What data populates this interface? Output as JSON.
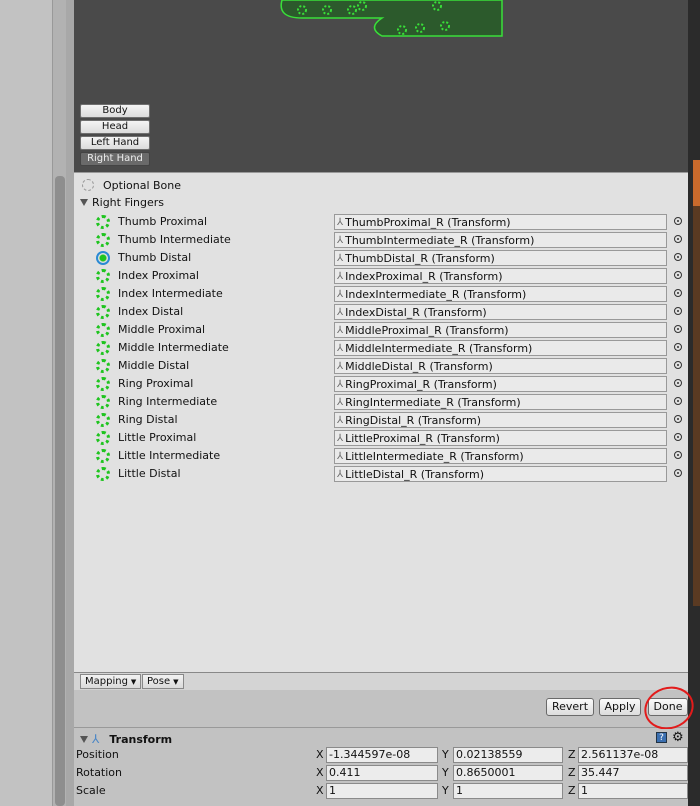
{
  "body_parts": {
    "items": [
      "Body",
      "Head",
      "Left Hand",
      "Right Hand"
    ],
    "active": "Right Hand"
  },
  "optional_bone_label": "Optional Bone",
  "section_title": "Right Fingers",
  "bones": [
    {
      "label": "Thumb Proximal",
      "value": "ThumbProximal_R (Transform)"
    },
    {
      "label": "Thumb Intermediate",
      "value": "ThumbIntermediate_R (Transform)"
    },
    {
      "label": "Thumb Distal",
      "value": "ThumbDistal_R (Transform)"
    },
    {
      "label": "Index Proximal",
      "value": "IndexProximal_R (Transform)"
    },
    {
      "label": "Index Intermediate",
      "value": "IndexIntermediate_R (Transform)"
    },
    {
      "label": "Index Distal",
      "value": "IndexDistal_R (Transform)"
    },
    {
      "label": "Middle Proximal",
      "value": "MiddleProximal_R (Transform)"
    },
    {
      "label": "Middle Intermediate",
      "value": "MiddleIntermediate_R (Transform)"
    },
    {
      "label": "Middle Distal",
      "value": "MiddleDistal_R (Transform)"
    },
    {
      "label": "Ring Proximal",
      "value": "RingProximal_R (Transform)"
    },
    {
      "label": "Ring Intermediate",
      "value": "RingIntermediate_R (Transform)"
    },
    {
      "label": "Ring Distal",
      "value": "RingDistal_R (Transform)"
    },
    {
      "label": "Little Proximal",
      "value": "LittleProximal_R (Transform)"
    },
    {
      "label": "Little Intermediate",
      "value": "LittleIntermediate_R (Transform)"
    },
    {
      "label": "Little Distal",
      "value": "LittleDistal_R (Transform)"
    }
  ],
  "tabs": {
    "mapping": "Mapping",
    "pose": "Pose"
  },
  "actions": {
    "revert": "Revert",
    "apply": "Apply",
    "done": "Done"
  },
  "transform": {
    "title": "Transform",
    "position": {
      "label": "Position",
      "x": "-1.344597e-08",
      "y": "0.02138559",
      "z": "2.561137e-08"
    },
    "rotation": {
      "label": "Rotation",
      "x": "0.411",
      "y": "0.8650001",
      "z": "35.447"
    },
    "scale": {
      "label": "Scale",
      "x": "1",
      "y": "1",
      "z": "1"
    },
    "axis_x": "X",
    "axis_y": "Y",
    "axis_z": "Z"
  },
  "colors": {
    "bone_mapped": "#1fc41f",
    "highlight_circle": "#e21b1b",
    "preview_bg": "#4a4a4a"
  }
}
